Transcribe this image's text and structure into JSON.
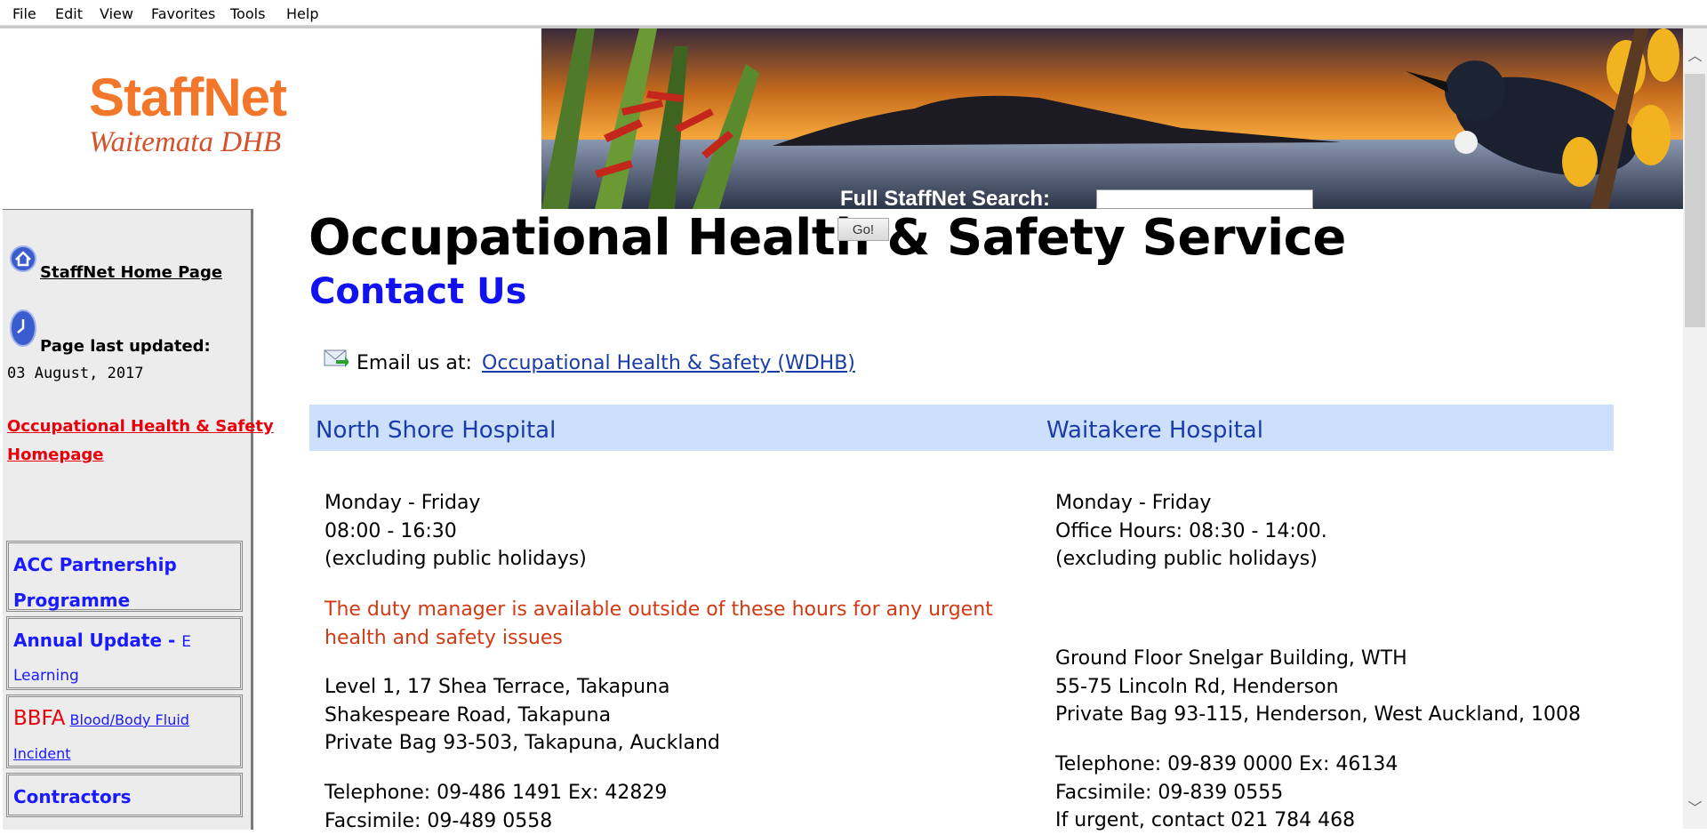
{
  "menu": [
    "File",
    "Edit",
    "View",
    "Favorites",
    "Tools",
    "Help"
  ],
  "banner": {
    "logo_main": "StaffNet",
    "logo_sub": "Waitemata DHB",
    "search_label": "Full StaffNet Search:",
    "search_value": "",
    "go_label": "Go!"
  },
  "sidebar": {
    "home_link": "StaffNet Home Page",
    "last_updated_label": "Page last updated:",
    "last_updated_date": "03 August, 2017",
    "ohs_home_link_1": "Occupational Health & Safety",
    "ohs_home_link_2": "Homepage",
    "boxes": {
      "acc_1": "ACC Partnership",
      "acc_2": "Programme",
      "annual_1": "Annual Update - ",
      "annual_e": "E",
      "annual_2": "Learning",
      "bbfa_big": "BBFA",
      "bbfa_1": "Blood/Body Fluid",
      "bbfa_2": "Incident",
      "contractors": "Contractors"
    }
  },
  "main": {
    "title": "Occupational Health & Safety Service",
    "subtitle": "Contact Us",
    "email_label": "Email us at:",
    "email_link": "Occupational Health & Safety (WDHB)",
    "north": {
      "heading": "North Shore Hospital",
      "days": "Monday - Friday",
      "hours": "08:00 - 16:30",
      "holidays": "(excluding public holidays)",
      "duty_1": "The duty manager is available outside of these hours for any urgent",
      "duty_2": "health and safety issues",
      "addr_1": "Level 1, 17 Shea Terrace, Takapuna",
      "addr_2": "Shakespeare Road, Takapuna",
      "addr_3": "Private Bag 93-503, Takapuna, Auckland",
      "phone": "Telephone: 09-486 1491 Ex: 42829",
      "fax": "Facsimile: 09-489 0558"
    },
    "waitakere": {
      "heading": "Waitakere Hospital",
      "days": "Monday - Friday",
      "hours": "Office Hours: 08:30 - 14:00.",
      "holidays": "(excluding public holidays)",
      "addr_1": "Ground Floor Snelgar Building, WTH",
      "addr_2": "55-75 Lincoln Rd, Henderson",
      "addr_3": "Private Bag 93-115, Henderson, West Auckland, 1008",
      "phone": "Telephone: 09-839 0000 Ex: 46134",
      "fax": "Facsimile: 09-839 0555",
      "urgent": "If urgent, contact 021 784 468"
    }
  },
  "colors": {
    "logo_orange": "#f2772b",
    "link_red": "#e8000b",
    "heading_blue": "#1212ee",
    "band_blue": "#cde0fb",
    "notice_red": "#d23a14"
  }
}
